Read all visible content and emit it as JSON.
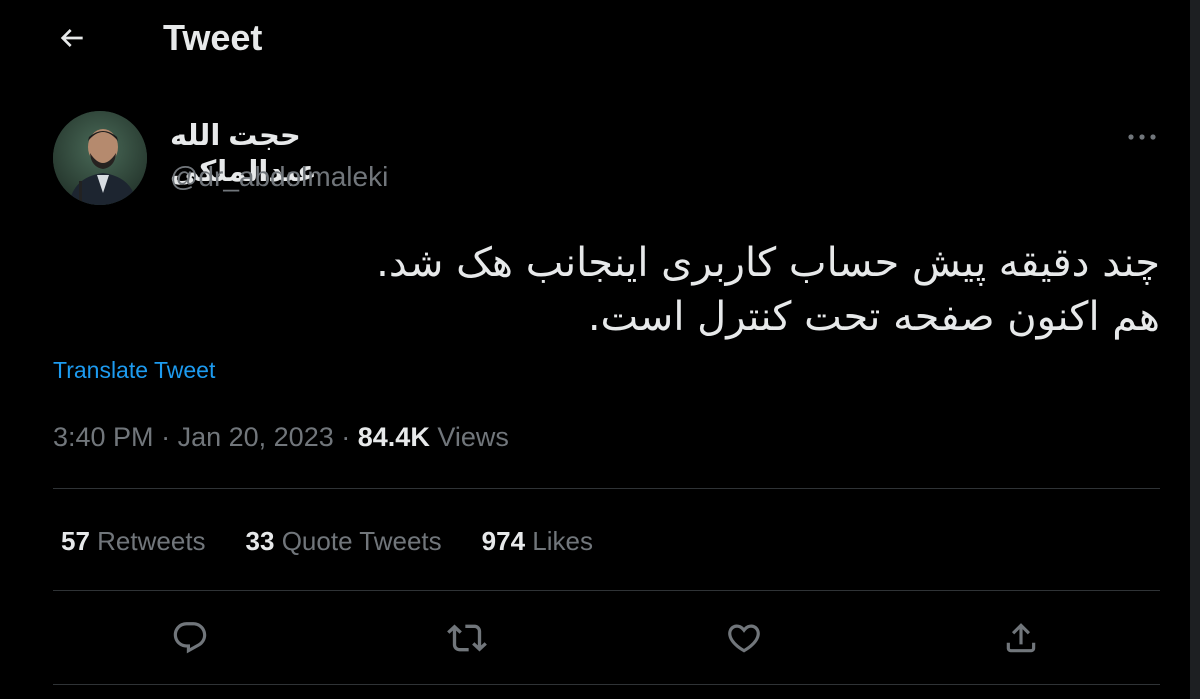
{
  "header": {
    "title": "Tweet",
    "back_icon": "arrow-left-icon"
  },
  "author": {
    "name": "حجت الله عبدالملکی",
    "handle": "@dr_abdolmaleki"
  },
  "tweet": {
    "line1": "چند دقیقه پیش حساب کاربری اینجانب هک شد.",
    "line2": "هم اکنون صفحه تحت کنترل است.",
    "translate_label": "Translate Tweet",
    "time": "3:40 PM",
    "separator": "·",
    "date": "Jan 20, 2023",
    "views_count": "84.4K",
    "views_label": "Views"
  },
  "stats": {
    "retweets_count": "57",
    "retweets_label": "Retweets",
    "quotes_count": "33",
    "quotes_label": "Quote Tweets",
    "likes_count": "974",
    "likes_label": "Likes"
  },
  "actions": {
    "reply": "reply-icon",
    "retweet": "retweet-icon",
    "like": "heart-icon",
    "share": "share-icon"
  },
  "colors": {
    "background": "#000000",
    "text": "#e7e9ea",
    "secondary": "#71767b",
    "accent": "#1d9bf0",
    "divider": "#2f3336"
  }
}
